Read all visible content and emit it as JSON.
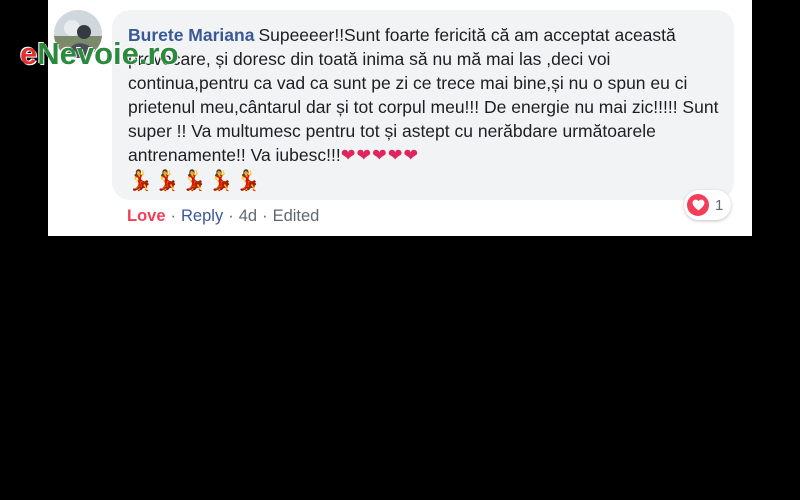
{
  "watermark": {
    "first_letter": "e",
    "rest": "Nevoie.ro"
  },
  "comment": {
    "author": "Burete Mariana",
    "text": "Supeeeer!!Sunt foarte fericită că am acceptat această provocare, și doresc din toată inima să nu mă mai las ,deci voi continua,pentru ca vad ca sunt pe zi ce trece mai bine,și nu o spun eu ci prietenul meu,cântarul dar și tot corpul meu!!! De energie nu mai zic!!!!! Sunt super !! Va multumesc pentru tot și astept cu nerăbdare următoarele antrenamente!! Va iubesc!!!",
    "hearts": "❤❤❤❤❤",
    "dancers": "💃💃💃💃💃"
  },
  "actions": {
    "love": "Love",
    "reply": "Reply",
    "time": "4d",
    "edited": "Edited",
    "separator": "·"
  },
  "reactions": {
    "icon": "heart-icon",
    "count": "1",
    "color": "#f33e58"
  },
  "colors": {
    "author": "#385898",
    "bubble": "#f2f3f5",
    "love": "#f33e58"
  }
}
